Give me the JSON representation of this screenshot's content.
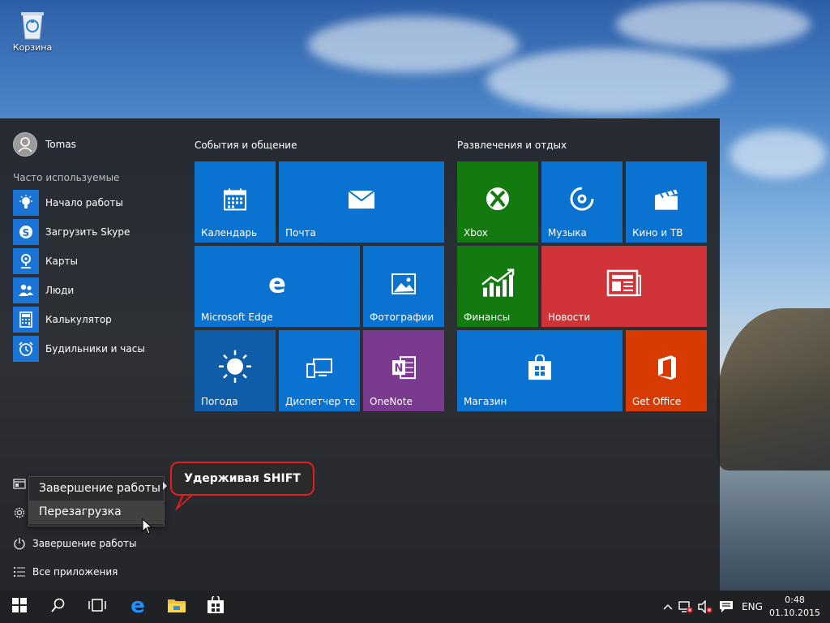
{
  "desktop": {
    "recycle_bin_label": "Корзина"
  },
  "start_menu": {
    "user_name": "Tomas",
    "most_used_label": "Часто используемые",
    "apps": [
      {
        "label": "Начало работы",
        "icon": "lightbulb-icon"
      },
      {
        "label": "Загрузить Skype",
        "icon": "skype-icon"
      },
      {
        "label": "Карты",
        "icon": "map-pin-icon"
      },
      {
        "label": "Люди",
        "icon": "people-icon"
      },
      {
        "label": "Калькулятор",
        "icon": "calculator-icon"
      },
      {
        "label": "Будильники и часы",
        "icon": "alarm-clock-icon"
      }
    ],
    "power_flyout": {
      "items": [
        "Завершение работы",
        "Перезагрузка"
      ],
      "hovered": "Перезагрузка"
    },
    "shutdown_label": "Завершение работы",
    "all_apps_label": "Все приложения",
    "groups": {
      "left_title": "События и общение",
      "right_title": "Развлечения и отдых"
    },
    "tiles": {
      "calendar": "Календарь",
      "mail": "Почта",
      "edge": "Microsoft Edge",
      "photos": "Фотографии",
      "weather": "Погода",
      "device_manager": "Диспетчер те...",
      "onenote": "OneNote",
      "xbox": "Xbox",
      "music": "Музыка",
      "movies": "Кино и ТВ",
      "finance": "Финансы",
      "news": "Новости",
      "store": "Магазин",
      "get_office": "Get Office"
    },
    "colors": {
      "blue": "#0a73d1",
      "green": "#127a0f",
      "purple": "#7a3a8f",
      "red": "#d13438",
      "orange": "#d83b01",
      "dark_blue": "#0f5ca8"
    }
  },
  "callout": {
    "text": "Удерживая SHIFT",
    "border_color": "#e81c1c"
  },
  "taskbar": {
    "language": "ENG",
    "time": "0:48",
    "date": "01.10.2015"
  }
}
